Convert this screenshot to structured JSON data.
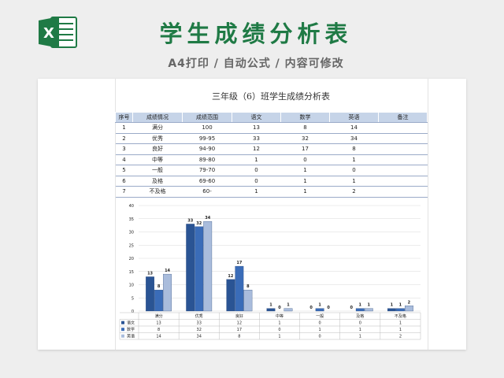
{
  "header": {
    "title": "学生成绩分析表",
    "subtitle": "A4打印 / 自动公式 / 内容可修改",
    "logo_icon": "excel-icon",
    "logo_color": "#1f7a45"
  },
  "report": {
    "title": "三年级（6）班学生成绩分析表"
  },
  "table": {
    "headers": [
      "序号",
      "成绩情况",
      "成绩范围",
      "语文",
      "数学",
      "英语",
      "备注"
    ],
    "rows": [
      [
        "1",
        "满分",
        "100",
        "13",
        "8",
        "14",
        ""
      ],
      [
        "2",
        "优秀",
        "99-95",
        "33",
        "32",
        "34",
        ""
      ],
      [
        "3",
        "良好",
        "94-90",
        "12",
        "17",
        "8",
        ""
      ],
      [
        "4",
        "中等",
        "89-80",
        "1",
        "0",
        "1",
        ""
      ],
      [
        "5",
        "一般",
        "79-70",
        "0",
        "1",
        "0",
        ""
      ],
      [
        "6",
        "及格",
        "69-60",
        "0",
        "1",
        "1",
        ""
      ],
      [
        "7",
        "不及格",
        "60-",
        "1",
        "1",
        "2",
        ""
      ]
    ]
  },
  "chart_data": {
    "type": "bar",
    "categories": [
      "满分",
      "优秀",
      "良好",
      "中等",
      "一般",
      "及格",
      "不及格"
    ],
    "series": [
      {
        "name": "语文",
        "values": [
          13,
          33,
          12,
          1,
          0,
          0,
          1
        ],
        "color": "#2a5494"
      },
      {
        "name": "数学",
        "values": [
          8,
          32,
          17,
          0,
          1,
          1,
          1
        ],
        "color": "#3a6cb8"
      },
      {
        "name": "英语",
        "values": [
          14,
          34,
          8,
          1,
          0,
          1,
          2
        ],
        "color": "#a9bcdc"
      }
    ],
    "ylim": [
      0,
      40
    ],
    "yticks": [
      "0",
      "5",
      "10",
      "15",
      "20",
      "25",
      "30",
      "35",
      "40"
    ],
    "grid": true,
    "legend": "data-table-below"
  }
}
